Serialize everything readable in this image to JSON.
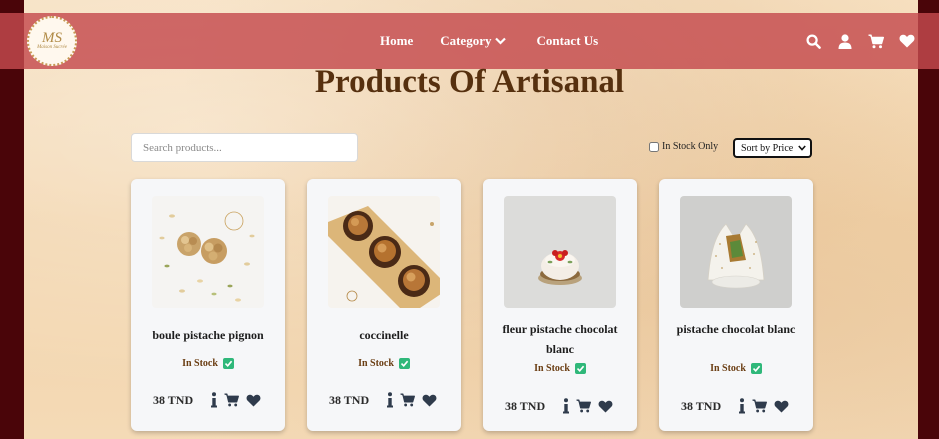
{
  "brand": {
    "logo_mono": "MS",
    "logo_sub": "Maison Sucrée"
  },
  "nav": {
    "home": "Home",
    "category": "Category",
    "contact": "Contact Us",
    "icons": [
      "search-icon",
      "user-icon",
      "cart-icon",
      "heart-icon"
    ]
  },
  "page": {
    "title": "Products Of Artisanal"
  },
  "filters": {
    "search_placeholder": "Search products...",
    "in_stock_label": "In Stock Only",
    "in_stock_checked": false,
    "sort_label": "Sort by Price"
  },
  "colors": {
    "navbar": "#c44a4e",
    "title": "#56300f",
    "icon_dark": "#2f3b4c",
    "stock_check": "#2fb87a",
    "page_side": "#4a0509"
  },
  "products": [
    {
      "name": "boule pistache pignon",
      "stock": "In Stock",
      "price": "38 TND"
    },
    {
      "name": "coccinelle",
      "stock": "In Stock",
      "price": "38 TND"
    },
    {
      "name": "fleur pistache chocolat blanc",
      "stock": "In Stock",
      "price": "38 TND"
    },
    {
      "name": "pistache chocolat blanc",
      "stock": "In Stock",
      "price": "38 TND"
    }
  ]
}
